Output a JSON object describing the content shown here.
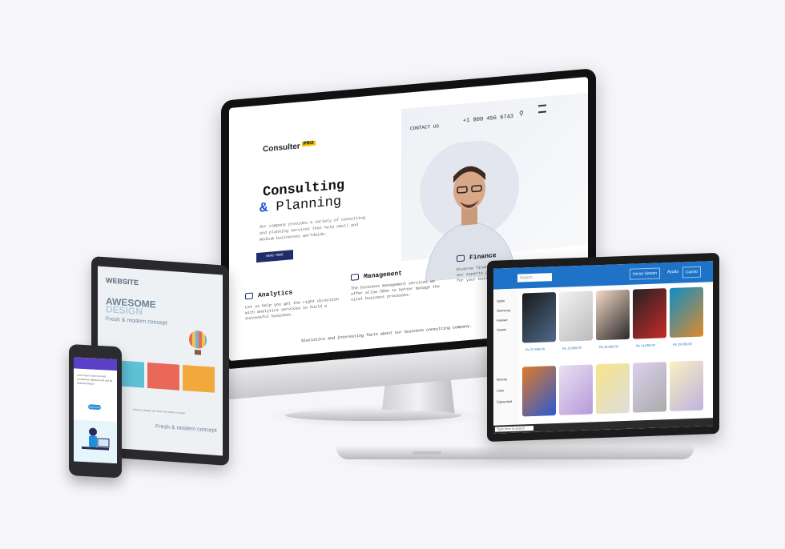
{
  "imac_site": {
    "logo": "Consulter",
    "logo_badge": "PRO",
    "nav_contact": "CONTACT US",
    "nav_phone": "+1 800 456 6743",
    "hero_title_line1": "Consulting",
    "hero_amp": "&",
    "hero_title_line2": "Planning",
    "hero_text": "Our company provides a variety of consulting and planning services that help small and medium businesses worldwide.",
    "hero_button": "READ MORE",
    "features": [
      {
        "title": "Analytics",
        "text": "Let us help you get the right direction with analytics services to build a successful business."
      },
      {
        "title": "Management",
        "text": "The business management services we offer allow CEOs to better manage the vital business processes."
      },
      {
        "title": "Finance",
        "text": "Diverse financial solutions provided by our experts guarantee increased profits for your business."
      }
    ],
    "footer_text": "Statistics and interesting facts about our business consulting company."
  },
  "laptop_shop": {
    "search_placeholder": "Search",
    "top_buttons": [
      "Iniciar Sesion",
      "Ayuda",
      "Carrito"
    ],
    "sidebar": [
      "Apple",
      "Samsung",
      "Huawei",
      "Xiaomi",
      "Marcas",
      "Color",
      "Capacidad"
    ],
    "prices": [
      "Rs 22,999.00",
      "Rs 13,999.00",
      "Rs 29,999.00",
      "Rs 14,999.00",
      "Rs 29,999.00"
    ],
    "taskbar_search": "Type here to search",
    "colors": {
      "brand": "#1e73c8"
    }
  },
  "tablet_site": {
    "title": "WEBSITE",
    "awesome": "AWESOME",
    "design": "DESIGN",
    "tagline": "Fresh & modern concept",
    "caption": "Awesome design with fresh and modern concept",
    "tagline2": "Fresh & modern concept",
    "card_colors": [
      "#5ec1d4",
      "#e9685a",
      "#f1a93c"
    ]
  },
  "phone_site": {
    "text": "Lorem ipsum dolor sit amet consectetur adipiscing elit sed do eiusmod tempor",
    "button": "Read more",
    "header_color": "#5a40c8"
  }
}
